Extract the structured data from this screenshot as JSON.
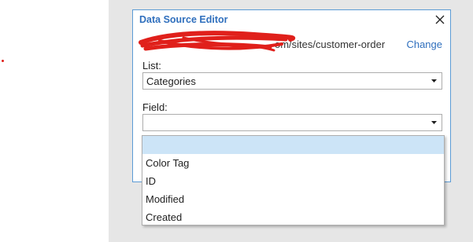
{
  "dialog": {
    "title": "Data Source Editor",
    "url_visible_text": "om/sites/customer-order",
    "change_label": "Change"
  },
  "list": {
    "label": "List:",
    "selected": "Categories"
  },
  "field": {
    "label": "Field:",
    "selected": "",
    "options": [
      "",
      "Color Tag",
      "ID",
      "Modified",
      "Created"
    ],
    "highlighted_index": 0
  },
  "icons": {
    "close": "close-icon",
    "dropdown_arrow": "dropdown-arrow-icon"
  },
  "colors": {
    "title": "#2f6fbd",
    "link": "#2f6fbd",
    "dialog_border": "#5b9bd5",
    "highlight": "#cce4f7",
    "redaction": "#e0201b"
  }
}
